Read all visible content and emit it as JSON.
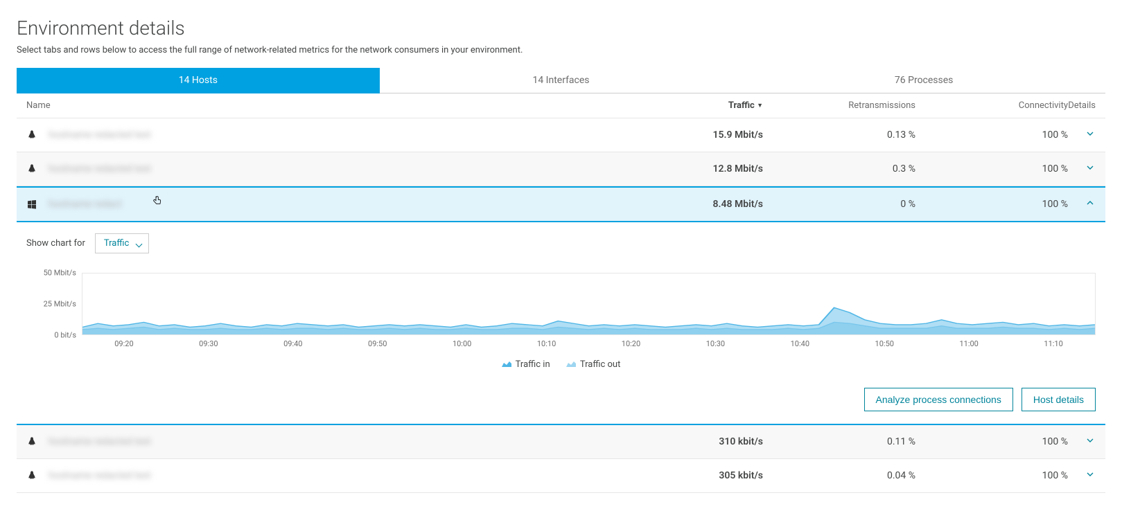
{
  "page": {
    "title": "Environment details",
    "subtitle": "Select tabs and rows below to access the full range of network-related metrics for the network consumers in your environment."
  },
  "tabs": [
    {
      "label": "14 Hosts",
      "active": true
    },
    {
      "label": "14 Interfaces",
      "active": false
    },
    {
      "label": "76 Processes",
      "active": false
    }
  ],
  "columns": {
    "name": "Name",
    "traffic": "Traffic",
    "retransmissions": "Retransmissions",
    "connectivity": "Connectivity",
    "details": "Details"
  },
  "rows": [
    {
      "os": "linux",
      "traffic": "15.9 Mbit/s",
      "retransmissions": "0.13 %",
      "connectivity": "100 %",
      "expanded": false
    },
    {
      "os": "linux",
      "traffic": "12.8 Mbit/s",
      "retransmissions": "0.3 %",
      "connectivity": "100 %",
      "expanded": false
    },
    {
      "os": "windows",
      "traffic": "8.48 Mbit/s",
      "retransmissions": "0 %",
      "connectivity": "100 %",
      "expanded": true
    },
    {
      "os": "linux",
      "traffic": "310 kbit/s",
      "retransmissions": "0.11 %",
      "connectivity": "100 %",
      "expanded": false
    },
    {
      "os": "linux",
      "traffic": "305 kbit/s",
      "retransmissions": "0.04 %",
      "connectivity": "100 %",
      "expanded": false
    }
  ],
  "chart_controls": {
    "label": "Show chart for",
    "selected": "Traffic"
  },
  "actions": {
    "analyze": "Analyze process connections",
    "host_details": "Host details"
  },
  "legend": {
    "in": "Traffic in",
    "out": "Traffic out"
  },
  "chart_data": {
    "type": "area",
    "title": "",
    "xlabel": "",
    "ylabel": "",
    "ylim": [
      0,
      50
    ],
    "yunit": "Mbit/s",
    "yticks": [
      "0 bit/s",
      "25 Mbit/s",
      "50 Mbit/s"
    ],
    "xticks": [
      "09:20",
      "09:30",
      "09:40",
      "09:50",
      "10:00",
      "10:10",
      "10:20",
      "10:30",
      "10:40",
      "10:50",
      "11:00",
      "11:10"
    ],
    "series": [
      {
        "name": "Traffic in",
        "color": "#4fb6e6",
        "values": [
          6,
          9,
          7,
          8,
          10,
          7,
          8,
          6,
          7,
          9,
          7,
          6,
          8,
          7,
          9,
          8,
          7,
          8,
          6,
          7,
          8,
          7,
          8,
          7,
          6,
          8,
          6,
          7,
          9,
          8,
          7,
          11,
          9,
          7,
          8,
          7,
          8,
          7,
          6,
          7,
          8,
          7,
          9,
          7,
          6,
          7,
          8,
          7,
          8,
          22,
          18,
          12,
          9,
          8,
          8,
          9,
          12,
          9,
          8,
          9,
          10,
          8,
          9,
          7,
          8,
          7,
          8
        ]
      },
      {
        "name": "Traffic out",
        "color": "#9dd5f0",
        "values": [
          4,
          5,
          4,
          5,
          6,
          4,
          5,
          4,
          4,
          5,
          4,
          4,
          5,
          4,
          5,
          5,
          4,
          5,
          4,
          4,
          5,
          4,
          5,
          4,
          4,
          5,
          4,
          4,
          5,
          5,
          4,
          6,
          5,
          4,
          5,
          4,
          5,
          4,
          4,
          4,
          5,
          4,
          5,
          4,
          4,
          4,
          5,
          4,
          5,
          10,
          9,
          7,
          5,
          5,
          5,
          5,
          7,
          5,
          5,
          5,
          6,
          5,
          5,
          4,
          5,
          4,
          5
        ]
      }
    ]
  }
}
